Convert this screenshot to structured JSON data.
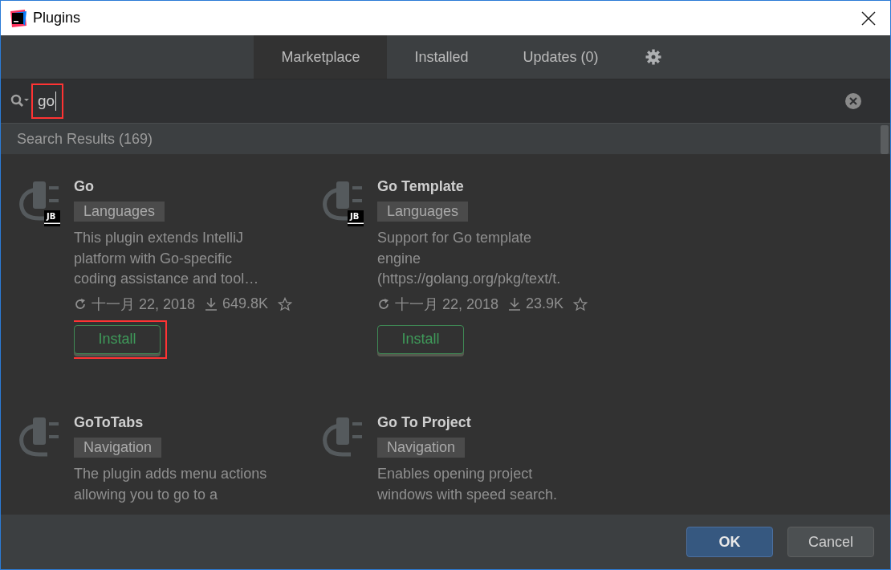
{
  "window": {
    "title": "Plugins"
  },
  "tabs": [
    {
      "label": "Marketplace",
      "selected": true
    },
    {
      "label": "Installed",
      "selected": false
    },
    {
      "label": "Updates (0)",
      "selected": false
    }
  ],
  "search": {
    "value": "go",
    "highlighted": true
  },
  "results_header": "Search Results (169)",
  "plugins": [
    {
      "name": "Go",
      "category": "Languages",
      "badge": "JB",
      "description": [
        "This plugin extends IntelliJ",
        "platform with Go-specific",
        "coding assistance and tool…"
      ],
      "updated": "十一月 22, 2018",
      "downloads": "649.8K",
      "install": "Install",
      "highlighted": true
    },
    {
      "name": "Go Template",
      "category": "Languages",
      "badge": "JB",
      "description": [
        "Support for Go template",
        "engine",
        "(https://golang.org/pkg/text/t."
      ],
      "updated": "十一月 22, 2018",
      "downloads": "23.9K",
      "install": "Install",
      "highlighted": false
    },
    {
      "name": "GoToTabs",
      "category": "Navigation",
      "description": [
        "The plugin adds menu actions",
        "allowing you to go to a"
      ]
    },
    {
      "name": "Go To Project",
      "category": "Navigation",
      "description": [
        "Enables opening project",
        "windows with speed search."
      ]
    }
  ],
  "buttons": [
    {
      "label": "OK",
      "kind": "primary"
    },
    {
      "label": "Cancel",
      "kind": "secondary"
    }
  ]
}
